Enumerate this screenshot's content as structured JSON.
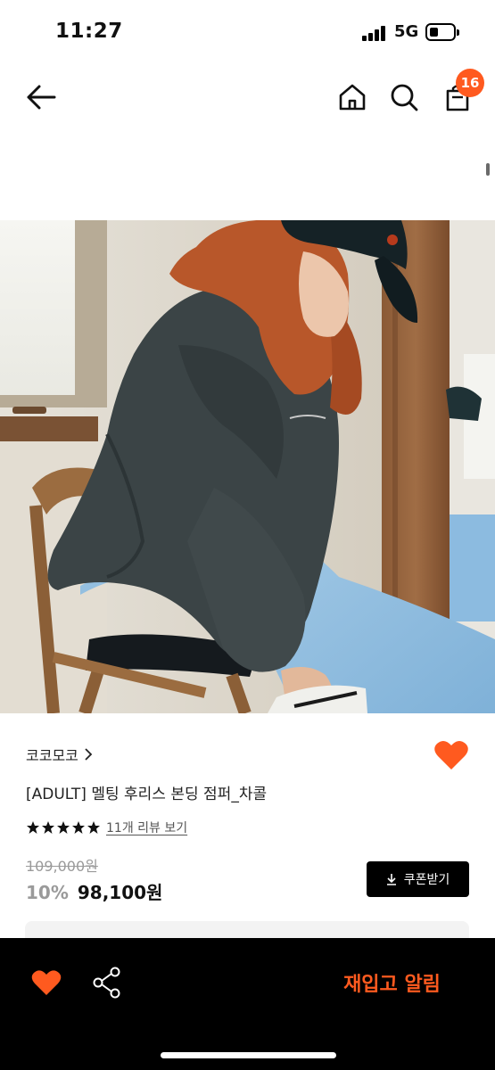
{
  "status_bar": {
    "time": "11:27",
    "network": "5G",
    "battery_level": 0.35
  },
  "header": {
    "cart_count": "16",
    "icons": [
      "back-arrow-icon",
      "home-icon",
      "search-icon",
      "shopping-bag-icon"
    ]
  },
  "product": {
    "image_alt": "Model in charcoal fleece jumper and light blue sweatpants sitting on a wooden chair",
    "brand": "코코모코",
    "title": "[ADULT] 멜팅 후리스 본딩 점퍼_차콜",
    "rating_stars": 5,
    "review_link": "11개 리뷰 보기",
    "original_price": "109,000원",
    "discount": "10%",
    "sale_price": "98,100원",
    "coupon_label": "쿠폰받기"
  },
  "bottom_bar": {
    "restock_label": "재입고 알림"
  },
  "colors": {
    "accent": "#ff5a1f",
    "background": "#ffffff",
    "bottom_bar": "#000000"
  }
}
